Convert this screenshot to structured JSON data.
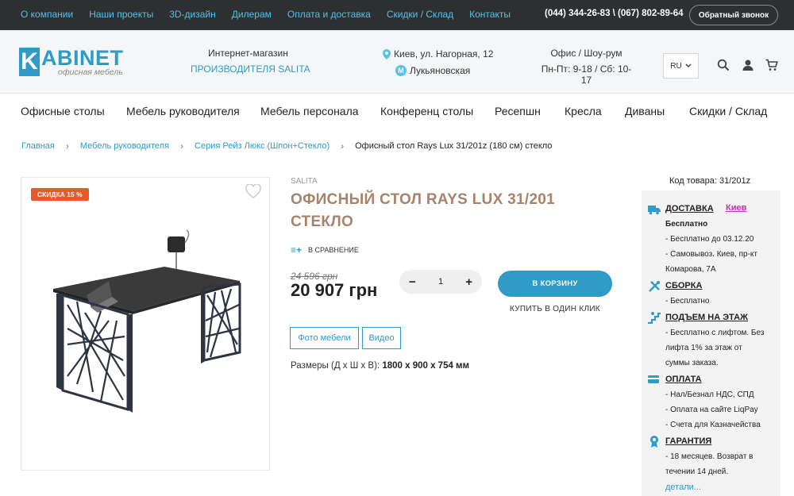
{
  "topbar": {
    "links": [
      "О компании",
      "Наши проекты",
      "3D-дизайн",
      "Дилерам",
      "Оплата и доставка",
      "Скидки / Склад",
      "Контакты"
    ],
    "phones": "(044) 344-26-83 \\ (067) 802-89-64",
    "callback": "Обратный звонок"
  },
  "header": {
    "logo_letter": "K",
    "logo_text": "ABINET",
    "logo_sub": "офисная мебель",
    "shop_line1": "Интернет-магазин",
    "shop_line2": "ПРОИЗВОДИТЕЛЯ SALITA",
    "address": "Киев, ул. Нагорная, 12",
    "metro_letter": "M",
    "metro": "Лукьяновская",
    "office_title": "Офис / Шоу-рум",
    "office_hours": "Пн-Пт: 9-18 / Сб: 10-17",
    "lang": "RU"
  },
  "menu": [
    "Офисные столы",
    "Мебель руководителя",
    "Мебель персонала",
    "Конференц столы",
    "Ресепшн",
    "Кресла",
    "Диваны",
    "Скидки / Склад"
  ],
  "breadcrumb": {
    "items": [
      "Главная",
      "Мебель руководителя",
      "Серия Рейз Люкс (Шпон+Стекло)"
    ],
    "current": "Офисный стол Rays Lux 31/201z (180 см) стекло",
    "separator": "›"
  },
  "product": {
    "discount": "СКИДКА 15 %",
    "brand": "SALITA",
    "title": "ОФИСНЫЙ СТОЛ RAYS LUX 31/201 СТЕКЛО",
    "compare": "В СРАВНЕНИЕ",
    "compare_icon": "≡+",
    "old_price": "24 596 грн",
    "price": "20 907 грн",
    "qty_minus": "−",
    "qty_value": "1",
    "qty_plus": "+",
    "cart": "В КОРЗИНУ",
    "one_click": "КУПИТЬ В ОДИН КЛИК",
    "btn_photo": "Фото мебели",
    "btn_video": "Видео",
    "dims_label": "Размеры (Д х Ш х В):",
    "dims_value": "1800 х 900 х 754 мм"
  },
  "side": {
    "code": "Код товара: 31/201z",
    "delivery_h": "ДОСТАВКА",
    "delivery_city": "Киев",
    "delivery_free": "Бесплатно",
    "delivery_l1": "- Бесплатно до 03.12.20",
    "delivery_l2": "- Самовывоз. Киев, пр-кт",
    "delivery_l3": "Комарова, 7А",
    "assembly_h": "СБОРКА",
    "assembly_l1": "- Бесплатно",
    "floor_h": "ПОДЪЕМ НА ЭТАЖ",
    "floor_l1": "- Бесплатно с лифтом. Без",
    "floor_l2": "лифта 1% за этаж от",
    "floor_l3": "суммы заказа.",
    "payment_h": "ОПЛАТА",
    "payment_l1": "- Нал/Безнал НДС, СПД",
    "payment_l2": "- Оплата на сайте LiqPay",
    "payment_l3": "- Счета для Казначейства",
    "warranty_h": "ГАРАНТИЯ",
    "warranty_l1": "- 18 месяцев. Возврат в",
    "warranty_l2": "течении 14 дней.",
    "more": "детали..."
  },
  "colors": {
    "accent": "#2f9bc6",
    "title": "#a8836b",
    "discount": "#e85a2c",
    "topbar": "#2e2f31",
    "city": "#c231b1"
  },
  "icons": [
    "pin-icon",
    "metro-icon",
    "search-icon",
    "user-icon",
    "cart-icon",
    "heart-icon",
    "truck-icon",
    "tools-icon",
    "stairs-icon",
    "card-icon",
    "medal-icon"
  ]
}
